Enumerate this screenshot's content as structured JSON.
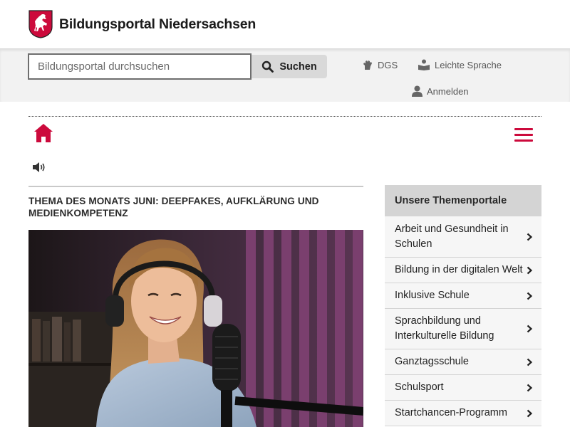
{
  "header": {
    "site_title": "Bildungsportal Niedersachsen",
    "crest_icon": "niedersachsen-horse-crest-icon",
    "accent_color": "#cc0a3c"
  },
  "search": {
    "placeholder": "Bildungsportal durchsuchen",
    "value": "",
    "button_label": "Suchen"
  },
  "utility_links": {
    "dgs": "DGS",
    "leichte_sprache": "Leichte Sprache",
    "login": "Anmelden"
  },
  "nav": {
    "home_icon": "home-icon",
    "menu_icon": "hamburger-menu-icon",
    "read_aloud_icon": "speaker-icon"
  },
  "article": {
    "title": "THEMA DES MONATS JUNI: DEEPFAKES, AUFKLÄRUNG UND MEDIENKOMPETENZ",
    "image_icon": "podcast-studio-photo"
  },
  "sidebar": {
    "heading": "Unsere Themenportale",
    "items": [
      {
        "label": "Arbeit und Gesundheit in Schulen"
      },
      {
        "label": "Bildung in der digitalen Welt"
      },
      {
        "label": "Inklusive Schule"
      },
      {
        "label": "Sprachbildung und Interkulturelle Bildung"
      },
      {
        "label": "Ganztagsschule"
      },
      {
        "label": "Schulsport"
      },
      {
        "label": "Startchancen-Programm"
      }
    ]
  }
}
